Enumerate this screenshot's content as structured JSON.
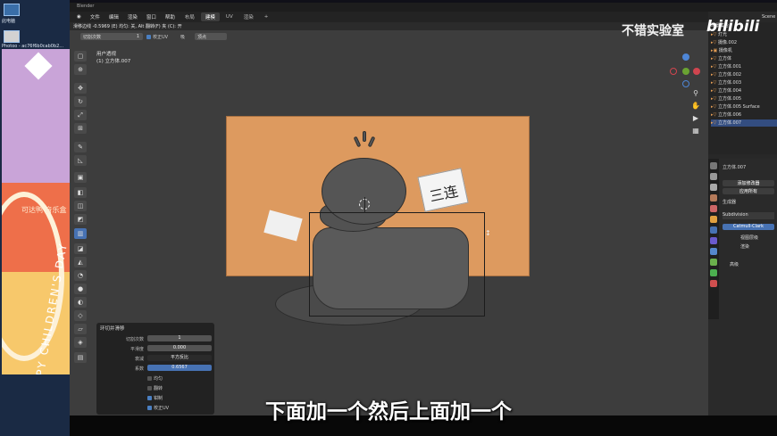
{
  "desktop": {
    "icons": [
      {
        "label": "此电脑",
        "icon": "computer-icon"
      },
      {
        "label": "Photoo - ac76f6b0cab0b2...",
        "icon": "image-file-icon"
      }
    ],
    "banner": {
      "text": "可达鸭 音乐盒",
      "vertical_text": "HAPPY CHILDREN'S DAY"
    }
  },
  "window": {
    "title": "Blender"
  },
  "menubar": {
    "items": [
      "文件",
      "编辑",
      "渲染",
      "窗口",
      "帮助"
    ],
    "workspace_tabs": [
      "布局",
      "建模",
      "UV",
      "渲染"
    ],
    "active_workspace": "建模"
  },
  "viewport": {
    "status_text": "滑移边线 -0.5969 (E) 均匀: 关, Alt 翻转(F) 夹 (C): 开",
    "tool_header": {
      "cuts_label": "切割次数",
      "cuts_value": "1",
      "correct_uv": "校正UV",
      "snap_label": "吸",
      "snap_value": "顶点"
    },
    "view_name": "用户透视",
    "object_name": "(1) 立方体.007",
    "card_text": "三连"
  },
  "operator_panel": {
    "title": "环切并滑移",
    "rows": [
      {
        "label": "切割次数",
        "value": "1"
      },
      {
        "label": "平滑度",
        "value": "0.000"
      },
      {
        "label": "衰减",
        "value": "平方反比"
      },
      {
        "label": "系数",
        "value": "0.6567"
      }
    ],
    "checks": [
      {
        "label": "均匀",
        "checked": false
      },
      {
        "label": "翻转",
        "checked": false
      },
      {
        "label": "钳制",
        "checked": true
      },
      {
        "label": "校正UV",
        "checked": true
      }
    ]
  },
  "outliner": {
    "scene_label": "Scene",
    "collection_label": "场景集合",
    "items": [
      "灯光",
      "摄像.002",
      "摄像机",
      "立方体",
      "立方体.001",
      "立方体.002",
      "立方体.003",
      "立方体.004",
      "立方体.005",
      "立方体.005 Surface",
      "立方体.006",
      "立方体.007"
    ],
    "selected": "立方体.007"
  },
  "properties": {
    "object_name": "立方体.007",
    "add_modifier": "添加修改器",
    "apply_all": "应用所有",
    "generate_label": "生成器",
    "modifier_name": "Subdivision",
    "catmull_clark": "Catmull-Clark",
    "simple": "简单",
    "levels_viewport": "视图层级",
    "render": "渲染",
    "advanced": "高级"
  },
  "logo": {
    "channel": "不错实验室",
    "bili": "bilibili"
  },
  "subtitle": "下面加一个然后上面加一个",
  "colors": {
    "accent": "#4772b3",
    "board": "#dd9a5f",
    "viewport_bg": "#3d3d3d"
  }
}
